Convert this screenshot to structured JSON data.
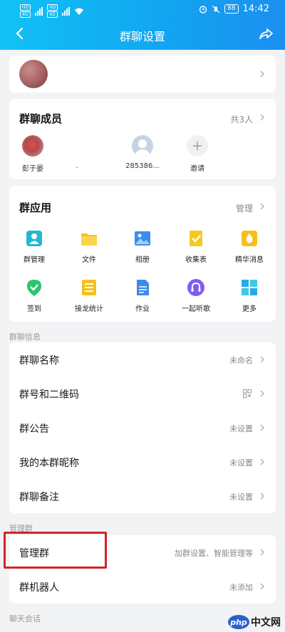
{
  "status_bar": {
    "time": "14:42",
    "battery": "88",
    "sim1": "HD",
    "sim2": "4G",
    "sim3": "HD",
    "sim4": "4G"
  },
  "nav": {
    "title": "群聊设置"
  },
  "members": {
    "title": "群聊成员",
    "count": "共3人",
    "items": [
      {
        "name": "彭于晏"
      },
      {
        "name": "."
      },
      {
        "name": "285386..."
      },
      {
        "name": "邀请"
      }
    ]
  },
  "apps": {
    "title": "群应用",
    "manage": "管理",
    "items": [
      {
        "label": "群管理",
        "icon": "group-manage-icon"
      },
      {
        "label": "文件",
        "icon": "folder-icon"
      },
      {
        "label": "相册",
        "icon": "photo-album-icon"
      },
      {
        "label": "收集表",
        "icon": "form-icon"
      },
      {
        "label": "精华消息",
        "icon": "essence-icon"
      },
      {
        "label": "签到",
        "icon": "check-in-icon"
      },
      {
        "label": "接龙统计",
        "icon": "relay-icon"
      },
      {
        "label": "作业",
        "icon": "homework-icon"
      },
      {
        "label": "一起听歌",
        "icon": "music-icon"
      },
      {
        "label": "更多",
        "icon": "more-apps-icon"
      }
    ]
  },
  "info": {
    "section_label": "群聊信息",
    "rows": [
      {
        "label": "群聊名称",
        "value": "未命名"
      },
      {
        "label": "群号和二维码",
        "value": ""
      },
      {
        "label": "群公告",
        "value": "未设置"
      },
      {
        "label": "我的本群昵称",
        "value": "未设置"
      },
      {
        "label": "群聊备注",
        "value": "未设置"
      }
    ]
  },
  "manage": {
    "section_label": "管理群",
    "rows": [
      {
        "label": "管理群",
        "value": "加群设置、智能管理等"
      },
      {
        "label": "群机器人",
        "value": "未添加"
      }
    ]
  },
  "chat": {
    "section_label": "聊天会话"
  },
  "watermark": {
    "logo": "php",
    "text": "中文网"
  },
  "colors": {
    "accent": "#12a6f1",
    "highlight": "#d0242b"
  }
}
